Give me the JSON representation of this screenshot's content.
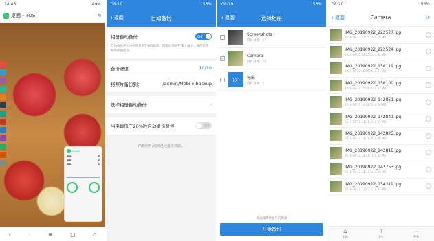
{
  "panel1": {
    "status_time": "18:45",
    "status_battery": "49%",
    "title": "桌面 - TOS",
    "widget_title": "Good"
  },
  "panel2": {
    "status_time": "08:19",
    "status_battery": "56%",
    "back_label": "返回",
    "title": "自动备份",
    "row_auto_backup": "相册自动备份",
    "toggle_on": "ON",
    "desc": "自动备份手机中的照片到TNAS设备，把美好的记忆安全备份，释放您手机的存储空间。",
    "row_progress_label": "备份进度",
    "row_progress_value": "10/10",
    "row_target_label": "将照片备份到：",
    "row_target_value": "/admin/Mobile backup",
    "row_select_album": "选择相册自动备份",
    "row_low_battery": "当电量低于20%时自动备份暂停",
    "toggle_off": "OFF",
    "footnote": "所有照片/视频已经备份完成。"
  },
  "panel3": {
    "status_time": "08:19",
    "status_battery": "56%",
    "back_label": "返回",
    "title": "选择相册",
    "albums": [
      {
        "name": "Screenshots",
        "count": "照片总数：17",
        "checked": false
      },
      {
        "name": "Camera",
        "count": "照片总数：10",
        "checked": true
      },
      {
        "name": "电影",
        "count": "照片总数：1",
        "checked": false
      }
    ],
    "hint": "请选择需要备份的目录",
    "start_button": "开始备份"
  },
  "panel4": {
    "status_time": "08:20",
    "status_battery": "56%",
    "back_label": "返回",
    "title": "Camera",
    "files": [
      {
        "name": "IMG_20190922_222527.jpg",
        "sub": "2019-09-22 22:25:29 4.29 MB"
      },
      {
        "name": "IMG_20190922_222524.jpg",
        "sub": "2019-09-22 22:25:24 4.44 MB"
      },
      {
        "name": "IMG_20190922_150119.jpg",
        "sub": "2019-09-22 15:01:21 4.21 MB"
      },
      {
        "name": "IMG_20190922_150100.jpg",
        "sub": "2019-09-22 15:01:01 4.02 MB"
      },
      {
        "name": "IMG_20190922_142851.jpg",
        "sub": "2019-09-22 14:28:53 4.56 MB"
      },
      {
        "name": "IMG_20190922_142841.jpg",
        "sub": "2019-09-22 14:28:42 4.51 MB"
      },
      {
        "name": "IMG_20190922_142825.jpg",
        "sub": "2019-09-22 14:28:26 4.36 MB"
      },
      {
        "name": "IMG_20190922_142818.jpg",
        "sub": "2019-09-22 14:28:19 4.45 MB"
      },
      {
        "name": "IMG_20190922_142753.jpg",
        "sub": "2019-09-22 14:27:54 4.26 MB"
      },
      {
        "name": "IMG_20190922_134319.jpg",
        "sub": "2019-09-22 13:43:21 3.83 MB"
      }
    ],
    "bottom": [
      {
        "label": "全选",
        "icon": "select-all-icon"
      },
      {
        "label": "上传",
        "icon": "upload-icon"
      },
      {
        "label": "更多",
        "icon": "more-icon"
      }
    ]
  },
  "colors": {
    "accent": "#2e86de",
    "shield": "#2ecc71"
  }
}
